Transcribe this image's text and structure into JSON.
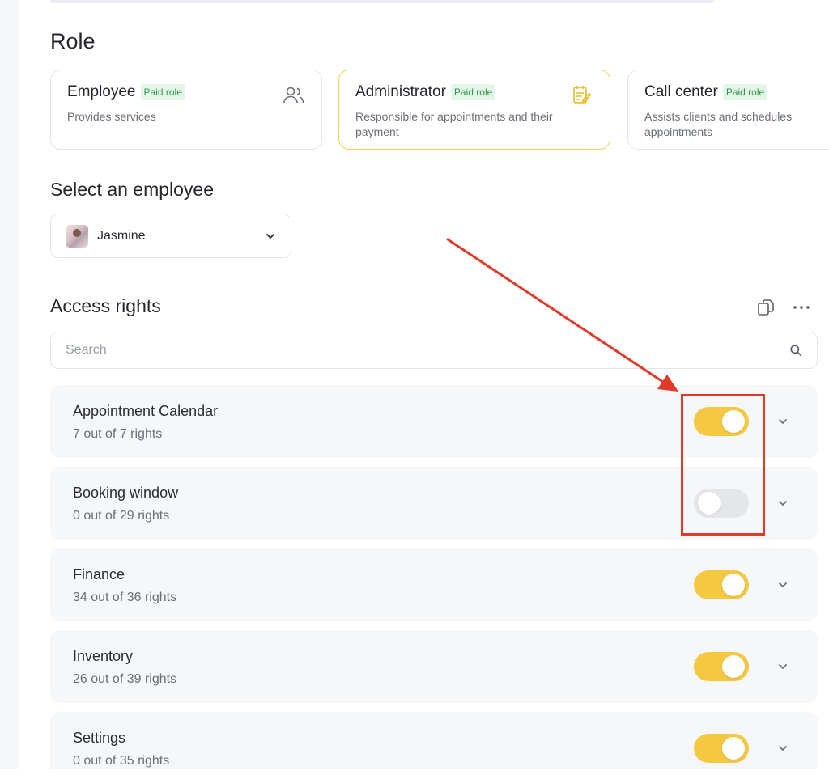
{
  "role": {
    "heading": "Role",
    "cards": [
      {
        "title": "Employee",
        "badge": "Paid role",
        "description": "Provides services",
        "icon": "users-icon",
        "selected": false
      },
      {
        "title": "Administrator",
        "badge": "Paid role",
        "description": "Responsible for appointments and their payment",
        "icon": "notepad-pencil-icon",
        "selected": true
      },
      {
        "title": "Call center",
        "badge": "Paid role",
        "description": "Assists clients and schedules appointments",
        "icon": "",
        "selected": false
      }
    ]
  },
  "employee_select": {
    "heading": "Select an employee",
    "selected_name": "Jasmine"
  },
  "access_rights": {
    "heading": "Access rights",
    "search_placeholder": "Search",
    "rows": [
      {
        "name": "Appointment Calendar",
        "count": "7 out of 7 rights",
        "enabled": true
      },
      {
        "name": "Booking window",
        "count": "0 out of 29 rights",
        "enabled": false
      },
      {
        "name": "Finance",
        "count": "34 out of 36 rights",
        "enabled": true
      },
      {
        "name": "Inventory",
        "count": "26 out of 39 rights",
        "enabled": true
      },
      {
        "name": "Settings",
        "count": "0 out of 35 rights",
        "enabled": true
      }
    ]
  },
  "colors": {
    "accent_yellow": "#f5c842",
    "badge_green": "#2f9a4a",
    "annotation_red": "#e13a2a"
  }
}
